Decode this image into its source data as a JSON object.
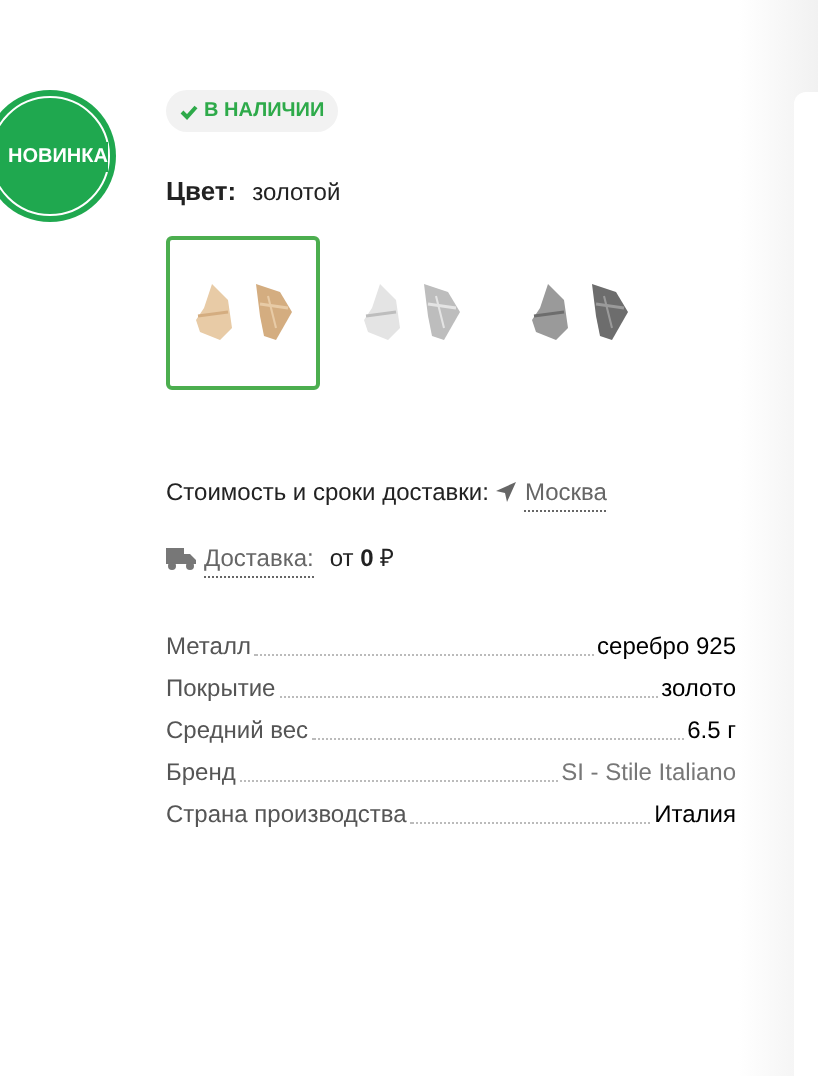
{
  "badge": "НОВИНКА",
  "stock": {
    "label": "В НАЛИЧИИ",
    "in_stock": true
  },
  "color_picker": {
    "label": "Цвет:",
    "value": "золотой",
    "swatches": [
      {
        "kind": "picture",
        "selected": true
      },
      {
        "kind": "picture",
        "selected": false
      },
      {
        "kind": "picture",
        "selected": false
      }
    ]
  },
  "delivery": {
    "label": "Стоимость и сроки доставки:",
    "city": "Москва",
    "method": "Доставка:",
    "price_prefix": "от",
    "price": "0",
    "currency": "₽"
  },
  "specs": [
    {
      "name": "Металл",
      "value": "серебро 925",
      "link": false
    },
    {
      "name": "Покрытие",
      "value": "золото",
      "link": false
    },
    {
      "name": "Средний вес",
      "value": "6.5 г",
      "link": false
    },
    {
      "name": "Бренд",
      "value": "SI - Stile Italiano",
      "link": true
    },
    {
      "name": "Страна производства",
      "value": "Италия",
      "link": false
    }
  ]
}
